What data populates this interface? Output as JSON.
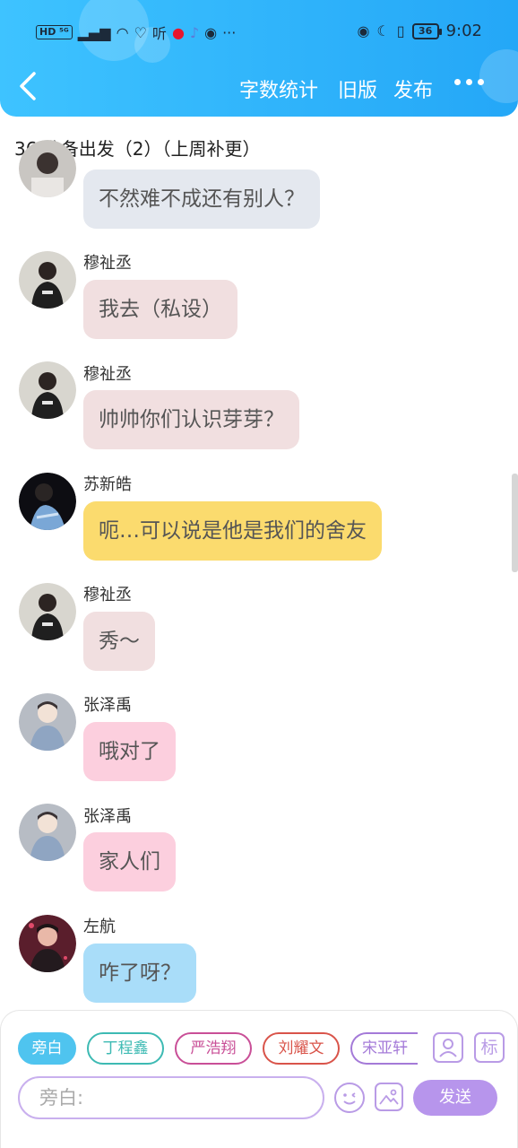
{
  "status_bar": {
    "left_text": "HD ⁵ᴳ",
    "listen_label": "听",
    "more": "···",
    "battery": "36",
    "time": "9:02"
  },
  "header": {
    "actions": [
      "字数统计",
      "旧版",
      "发布"
    ]
  },
  "chapter_title": "36 准备出发（2）（上周补更）",
  "messages": [
    {
      "name": "",
      "text": "不然难不成还有别人？",
      "color": "#e4e8ef"
    },
    {
      "name": "穆祉丞",
      "text": "我去（私设）",
      "color": "#f1dfe0"
    },
    {
      "name": "穆祉丞",
      "text": "帅帅你们认识芽芽？",
      "color": "#f1dfe0"
    },
    {
      "name": "苏新皓",
      "text": "呃…可以说是他是我们的舍友",
      "color": "#fbdb6e"
    },
    {
      "name": "穆祉丞",
      "text": "秀～",
      "color": "#f1dfe0"
    },
    {
      "name": "张泽禹",
      "text": "哦对了",
      "color": "#fccfde"
    },
    {
      "name": "张泽禹",
      "text": "家人们",
      "color": "#fccfde"
    },
    {
      "name": "左航",
      "text": "咋了呀？",
      "color": "#a9ddf9"
    }
  ],
  "roles": [
    {
      "label": "旁白",
      "color": "#4fc4ef",
      "selected": true
    },
    {
      "label": "丁程鑫",
      "color": "#3dbab3",
      "selected": false
    },
    {
      "label": "严浩翔",
      "color": "#c94f97",
      "selected": false
    },
    {
      "label": "刘耀文",
      "color": "#d9544a",
      "selected": false
    },
    {
      "label": "宋亚轩",
      "color": "#a47ad8",
      "selected": false
    }
  ],
  "tag_label": "标",
  "input": {
    "placeholder": "旁白:"
  },
  "send_label": "发送"
}
